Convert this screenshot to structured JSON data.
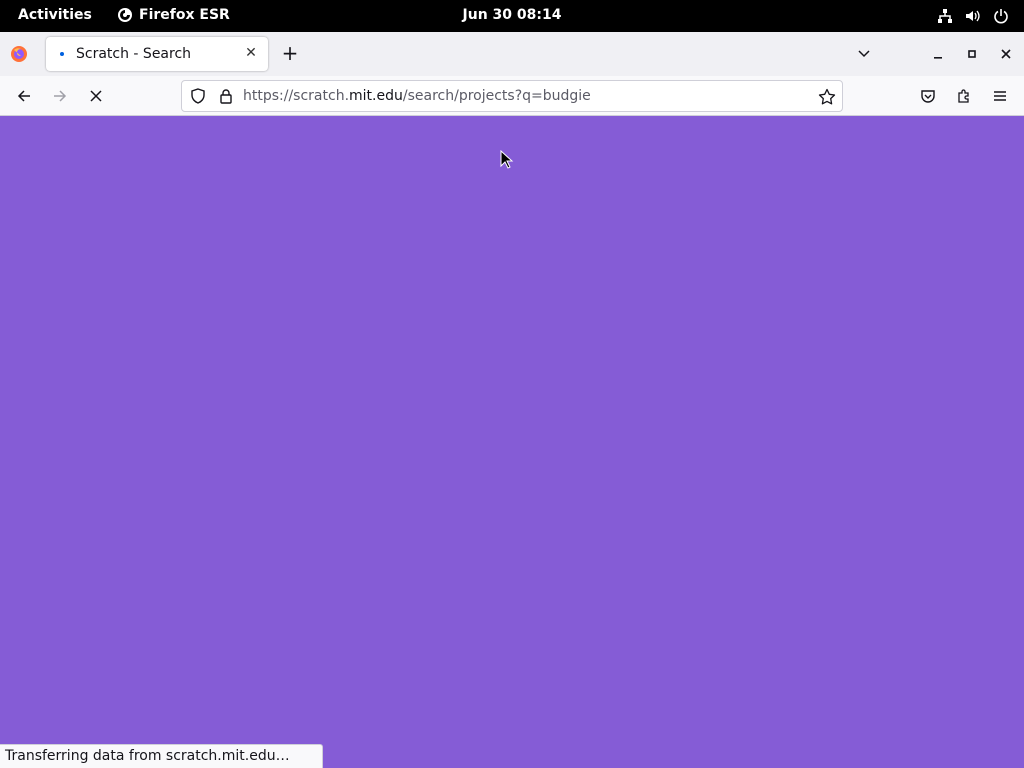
{
  "topbar": {
    "activities": "Activities",
    "app_name": "Firefox ESR",
    "datetime": "Jun 30  08:14"
  },
  "tab": {
    "title": "Scratch - Search"
  },
  "urlbar": {
    "url_prefix": "https://scratch.",
    "url_domain": "mit.edu",
    "url_path": "/search/projects?q=budgie"
  },
  "statusbar": {
    "text": "Transferring data from scratch.mit.edu…"
  },
  "colors": {
    "page_background": "#855cd6",
    "topbar": "#000000",
    "accent": "#0060df"
  },
  "icons": {
    "topbar": [
      "firefox-esr-icon",
      "network-icon",
      "volume-icon",
      "power-icon"
    ],
    "toolbar": [
      "firefox-icon",
      "list-all-tabs-icon",
      "minimize-icon",
      "maximize-icon",
      "close-window-icon",
      "back-icon",
      "forward-icon",
      "stop-icon",
      "shield-icon",
      "lock-icon",
      "bookmark-star-icon",
      "pocket-icon",
      "extensions-icon",
      "menu-icon"
    ]
  }
}
